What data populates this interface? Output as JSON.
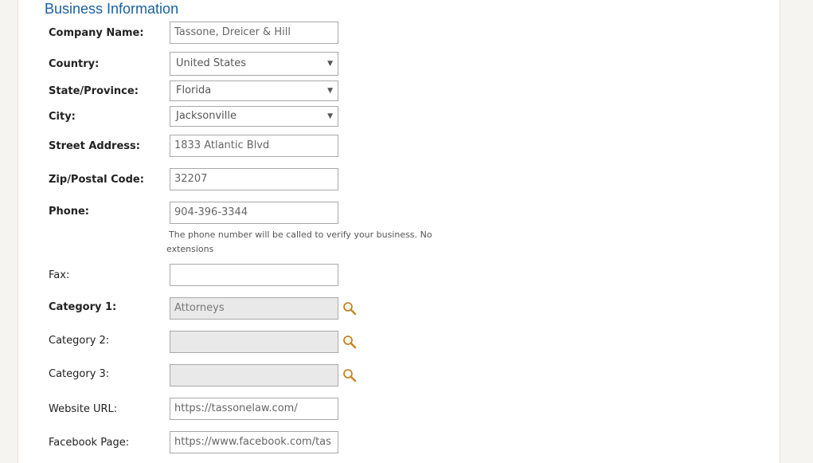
{
  "section": {
    "title": "Business Information"
  },
  "fields": {
    "company_name": {
      "label": "Company Name:",
      "value": "Tassone, Dreicer & Hill"
    },
    "country": {
      "label": "Country:",
      "value": "United States"
    },
    "state": {
      "label": "State/Province:",
      "value": "Florida"
    },
    "city": {
      "label": "City:",
      "value": "Jacksonville"
    },
    "street": {
      "label": "Street Address:",
      "value": "1833 Atlantic Blvd"
    },
    "zip": {
      "label": "Zip/Postal Code:",
      "value": "32207"
    },
    "phone": {
      "label": "Phone:",
      "value": "904-396-3344",
      "hint": "The phone number will be called to verify your business. No extensions"
    },
    "fax": {
      "label": "Fax:",
      "value": ""
    },
    "category1": {
      "label": "Category 1:",
      "value": "Attorneys"
    },
    "category2": {
      "label": "Category 2:",
      "value": ""
    },
    "category3": {
      "label": "Category 3:",
      "value": ""
    },
    "website": {
      "label": "Website URL:",
      "value": "https://tassonelaw.com/"
    },
    "facebook": {
      "label": "Facebook Page:",
      "value": "https://www.facebook.com/tas"
    }
  },
  "icons": {
    "select_caret": "chevron-down-icon",
    "category_search": "magnifier-icon"
  },
  "colors": {
    "section_title": "#1b5f9e",
    "magnifier": "#c9872a"
  }
}
